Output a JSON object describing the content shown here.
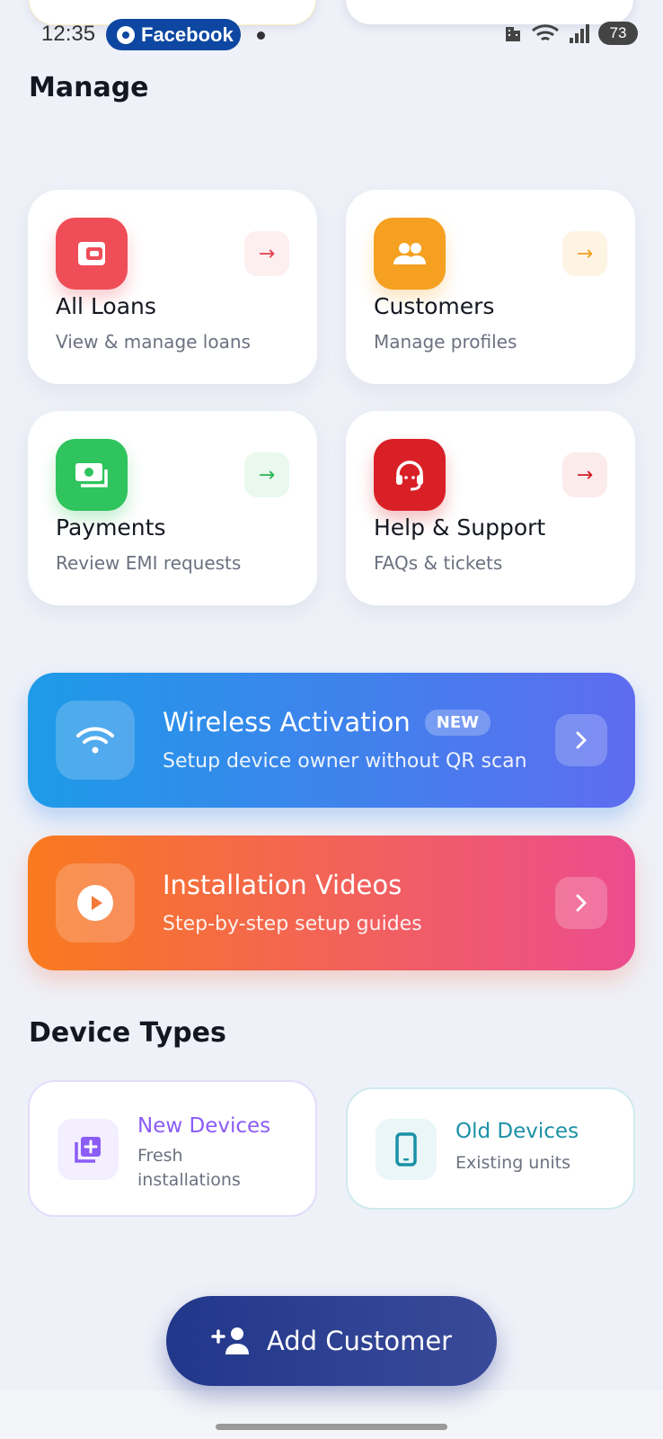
{
  "status_bar": {
    "time": "12:35",
    "notification_app": "Facebook",
    "battery": "73"
  },
  "manage": {
    "title": "Manage",
    "cards": [
      {
        "title": "All Loans",
        "subtitle": "View & manage loans",
        "icon": "wallet-icon",
        "accent": "#ef4d58"
      },
      {
        "title": "Customers",
        "subtitle": "Manage profiles",
        "icon": "people-icon",
        "accent": "#f5a020"
      },
      {
        "title": "Payments",
        "subtitle": "Review EMI requests",
        "icon": "cash-icon",
        "accent": "#2fc45d"
      },
      {
        "title": "Help & Support",
        "subtitle": "FAQs & tickets",
        "icon": "headset-icon",
        "accent": "#d92027"
      }
    ]
  },
  "banners": [
    {
      "title": "Wireless Activation",
      "badge": "NEW",
      "subtitle": "Setup device owner without QR scan",
      "icon": "wifi-icon",
      "gradient": [
        "#1d9be8",
        "#5e6cf0"
      ]
    },
    {
      "title": "Installation Videos",
      "subtitle": "Step-by-step setup guides",
      "icon": "play-icon",
      "gradient": [
        "#f97a1f",
        "#ec4c8f"
      ]
    }
  ],
  "device_types": {
    "title": "Device Types",
    "items": [
      {
        "title": "New Devices",
        "subtitle_line1": "Fresh",
        "subtitle_line2": "installations",
        "icon": "add-box-icon",
        "accent": "#8b5cf6"
      },
      {
        "title": "Old Devices",
        "subtitle": "Existing units",
        "icon": "smartphone-icon",
        "accent": "#1b91a6"
      }
    ]
  },
  "fab": {
    "label": "Add Customer",
    "icon": "add-person-icon"
  }
}
